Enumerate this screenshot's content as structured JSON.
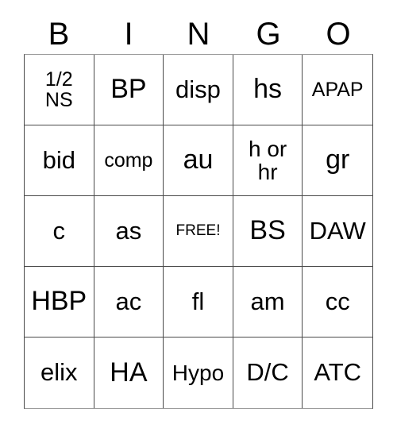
{
  "card": {
    "title": "BINGO",
    "header": {
      "letters": [
        "B",
        "I",
        "N",
        "G",
        "O"
      ]
    },
    "free_space": {
      "label": "FREE!",
      "row": 2,
      "column": 2
    },
    "colors": {
      "text": "#000000",
      "background": "#ffffff",
      "grid_line": "#4a4a4a",
      "grid_outer_line": "#9a9a9a"
    },
    "grid": {
      "rows": 5,
      "columns": 5,
      "cells": [
        [
          {
            "text": "1/2\nNS",
            "size": "sm"
          },
          {
            "text": "BP",
            "size": "xl"
          },
          {
            "text": "disp",
            "size": "lg"
          },
          {
            "text": "hs",
            "size": "xl"
          },
          {
            "text": "APAP",
            "size": "sm"
          }
        ],
        [
          {
            "text": "bid",
            "size": "lg"
          },
          {
            "text": "comp",
            "size": "sm"
          },
          {
            "text": "au",
            "size": "xl"
          },
          {
            "text": "h or\nhr",
            "size": "md"
          },
          {
            "text": "gr",
            "size": "xl"
          }
        ],
        [
          {
            "text": "c",
            "size": "lg"
          },
          {
            "text": "as",
            "size": "lg"
          },
          {
            "text": "FREE!",
            "size": "free"
          },
          {
            "text": "BS",
            "size": "xl"
          },
          {
            "text": "DAW",
            "size": "lg"
          }
        ],
        [
          {
            "text": "HBP",
            "size": "xl"
          },
          {
            "text": "ac",
            "size": "lg"
          },
          {
            "text": "fl",
            "size": "lg"
          },
          {
            "text": "am",
            "size": "lg"
          },
          {
            "text": "cc",
            "size": "lg"
          }
        ],
        [
          {
            "text": "elix",
            "size": "lg"
          },
          {
            "text": "HA",
            "size": "xl"
          },
          {
            "text": "Hypo",
            "size": "md"
          },
          {
            "text": "D/C",
            "size": "lg"
          },
          {
            "text": "ATC",
            "size": "lg"
          }
        ]
      ]
    }
  }
}
